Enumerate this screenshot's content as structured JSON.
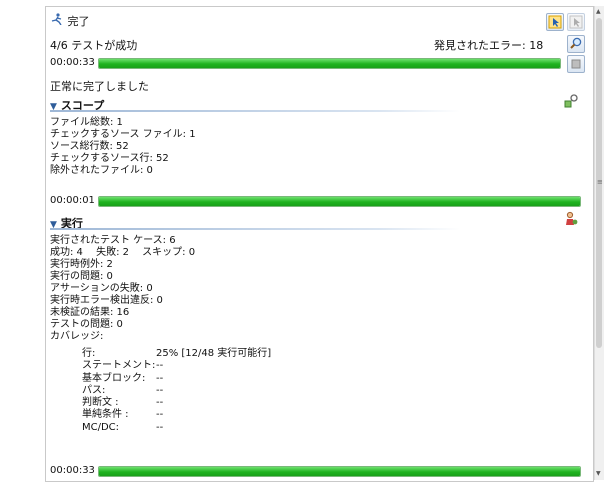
{
  "header": {
    "status_label": "完了",
    "tests_summary": "4/6 テストが成功",
    "errors_found": "発見されたエラー: 18"
  },
  "progress": {
    "main": {
      "time": "00:00:33",
      "fraction": 1.0
    },
    "scope": {
      "time": "00:00:01",
      "fraction": 1.0
    },
    "run": {
      "time": "00:00:33",
      "fraction": 1.0
    }
  },
  "completion_message": "正常に完了しました",
  "scope": {
    "title": "スコープ",
    "lines": [
      "ファイル総数: 1",
      "チェックするソース ファイル: 1",
      "ソース総行数: 52",
      "チェックするソース行: 52",
      "除外されたファイル: 0"
    ]
  },
  "run": {
    "title": "実行",
    "lines": [
      "実行されたテスト ケース: 6",
      "成功: 4　 失敗: 2　 スキップ: 0",
      "実行時例外: 2",
      "実行の問題: 0",
      "アサーションの失敗: 0",
      "実行時エラー検出違反: 0",
      "未検証の結果: 16",
      "テストの問題: 0",
      "カバレッジ:"
    ],
    "coverage": [
      {
        "label": "行:",
        "value": "25% [12/48 実行可能行]"
      },
      {
        "label": "ステートメント:",
        "value": "--"
      },
      {
        "label": "基本ブロック:",
        "value": "--"
      },
      {
        "label": "パス:",
        "value": "--"
      },
      {
        "label": "判断文 :",
        "value": "--"
      },
      {
        "label": "単純条件 :",
        "value": "--"
      },
      {
        "label": "MC/DC:",
        "value": "--"
      }
    ]
  },
  "colors": {
    "progress_green": "#1fb31f",
    "section_blue": "#2f5d9a"
  },
  "icons": {
    "status": "running-figure-icon",
    "toolbar_1": "cursor-select-icon",
    "toolbar_2": "cursor-select-disabled-icon",
    "details": "magnifier-icon",
    "stop": "stop-icon",
    "scope_action": "scope-key-icon",
    "run_action": "run-person-icon"
  }
}
